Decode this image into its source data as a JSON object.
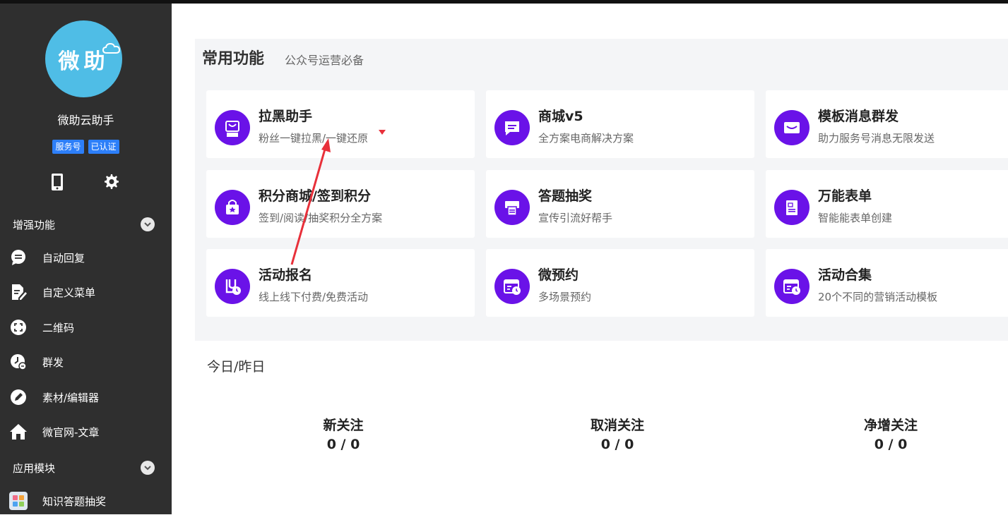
{
  "account": {
    "avatar_text": "微助",
    "name": "微助云助手",
    "badges": [
      "服务号",
      "已认证"
    ]
  },
  "sidebar": {
    "section_enhanced": "增强功能",
    "enhanced_items": [
      {
        "label": "自动回复",
        "icon": "chat-bubble-icon"
      },
      {
        "label": "自定义菜单",
        "icon": "edit-document-icon"
      },
      {
        "label": "二维码",
        "icon": "qrcode-scan-icon"
      },
      {
        "label": "群发",
        "icon": "clock-send-icon"
      },
      {
        "label": "素材/编辑器",
        "icon": "pencil-icon"
      },
      {
        "label": "微官网-文章",
        "icon": "home-icon"
      }
    ],
    "section_apps": "应用模块",
    "app_items": [
      {
        "label": "知识答题抽奖",
        "icon": "quiz-app-icon"
      }
    ]
  },
  "common": {
    "title": "常用功能",
    "subtitle": "公众号运营必备",
    "cards": [
      {
        "title": "拉黑助手",
        "desc": "粉丝一键拉黑/一键还原",
        "icon": "bag-helper-icon"
      },
      {
        "title": "商城v5",
        "desc": "全方案电商解决方案",
        "icon": "message-card-icon"
      },
      {
        "title": "模板消息群发",
        "desc": "助力服务号消息无限发送",
        "icon": "mail-icon"
      },
      {
        "title": "积分商城/签到积分",
        "desc": "签到/阅读/抽奖积分全方案",
        "icon": "star-bag-icon"
      },
      {
        "title": "答题抽奖",
        "desc": "宣传引流好帮手",
        "icon": "printer-icon"
      },
      {
        "title": "万能表单",
        "desc": "智能能表单创建",
        "icon": "form-icon"
      },
      {
        "title": "活动报名",
        "desc": "线上线下付费/免费活动",
        "icon": "signup-clock-icon"
      },
      {
        "title": "微预约",
        "desc": "多场景预约",
        "icon": "calendar-clock-icon"
      },
      {
        "title": "活动合集",
        "desc": "20个不同的营销活动模板",
        "icon": "calendar-clock-icon"
      }
    ]
  },
  "stats": {
    "title": "今日/昨日",
    "items": [
      {
        "label": "新关注",
        "value": "0 / 0"
      },
      {
        "label": "取消关注",
        "value": "0 / 0"
      },
      {
        "label": "净增关注",
        "value": "0 / 0"
      }
    ]
  },
  "colors": {
    "sidebar_bg": "#2f2f2f",
    "accent_purple": "#6a12e8",
    "badge_blue": "#2d7ff9",
    "avatar_blue": "#4fbde6",
    "annotation_red": "#e8303a"
  }
}
